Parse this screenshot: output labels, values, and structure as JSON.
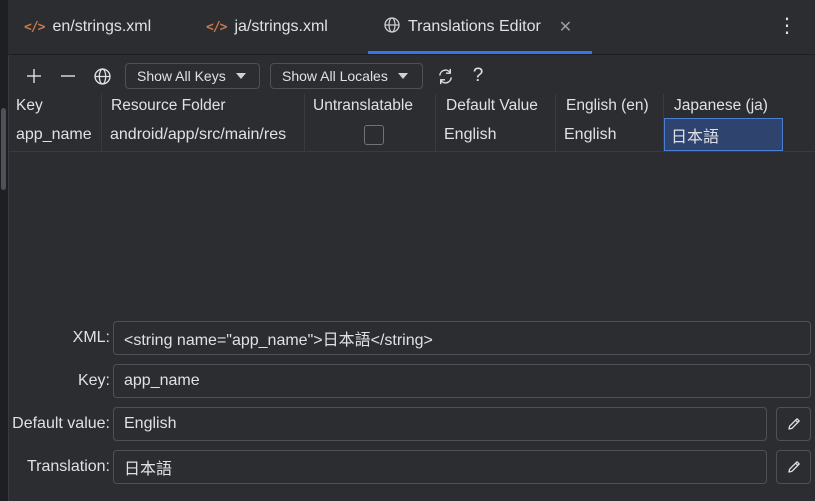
{
  "tabs": [
    {
      "label": "en/strings.xml",
      "icon": "xml-file-icon"
    },
    {
      "label": "ja/strings.xml",
      "icon": "xml-file-icon"
    },
    {
      "label": "Translations Editor",
      "icon": "globe-icon",
      "active": true
    }
  ],
  "toolbar": {
    "show_keys": "Show All Keys",
    "show_locales": "Show All Locales",
    "help": "?"
  },
  "table": {
    "columns": [
      "Key",
      "Resource Folder",
      "Untranslatable",
      "Default Value",
      "English (en)",
      "Japanese (ja)"
    ],
    "rows": [
      {
        "key": "app_name",
        "resource_folder": "android/app/src/main/res",
        "untranslatable": false,
        "default_value": "English",
        "english": "English",
        "japanese": "日本語"
      }
    ]
  },
  "form": {
    "xml_label": "XML:",
    "xml_value": "<string name=\"app_name\">日本語</string>",
    "key_label": "Key:",
    "key_value": "app_name",
    "default_label": "Default value:",
    "default_value": "English",
    "translation_label": "Translation:",
    "translation_value": "日本語"
  },
  "colors": {
    "background": "#2b2d30",
    "accent": "#3574f0",
    "selection": "#2e436e",
    "xml_icon": "#c77a4a"
  }
}
